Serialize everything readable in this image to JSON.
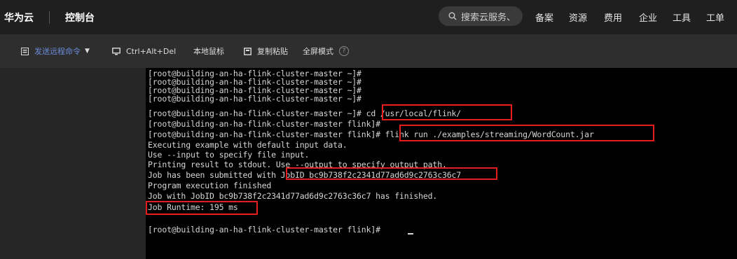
{
  "topbar": {
    "brand": "华为云",
    "console": "控制台",
    "search_placeholder": "搜索云服务、",
    "nav": [
      "备案",
      "资源",
      "费用",
      "企业",
      "工具",
      "工单"
    ]
  },
  "toolbar": {
    "send_command": "发送远程命令",
    "ctrl_alt_del": "Ctrl+Alt+Del",
    "local_mouse": "本地鼠标",
    "copy_paste": "复制粘贴",
    "fullscreen": "全屏模式",
    "help": "?"
  },
  "terminal": {
    "lines": [
      "[root@building-an-ha-flink-cluster-master ~]#",
      "[root@building-an-ha-flink-cluster-master ~]#",
      "[root@building-an-ha-flink-cluster-master ~]#",
      "[root@building-an-ha-flink-cluster-master ~]#",
      "[root@building-an-ha-flink-cluster-master ~]# cd /usr/local/flink/",
      "[root@building-an-ha-flink-cluster-master flink]#",
      "[root@building-an-ha-flink-cluster-master flink]# flink run ./examples/streaming/WordCount.jar",
      "Executing example with default input data.",
      "Use --input to specify file input.",
      "Printing result to stdout. Use --output to specify output path.",
      "Job has been submitted with JobID bc9b738f2c2341d77ad6d9c2763c36c7",
      "Program execution finished",
      "Job with JobID bc9b738f2c2341d77ad6d9c2763c36c7 has finished.",
      "Job Runtime: 195 ms",
      "",
      "[root@building-an-ha-flink-cluster-master flink]#"
    ]
  },
  "colors": {
    "highlight": "#e51d1d",
    "terminal_bg": "#000000",
    "link_blue": "#6a8cd9"
  }
}
